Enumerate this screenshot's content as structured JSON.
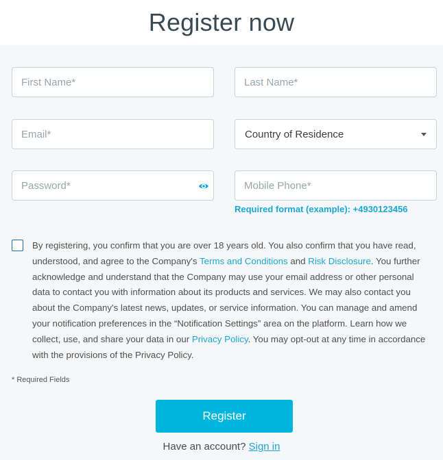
{
  "header": {
    "title": "Register now"
  },
  "form": {
    "first_name": {
      "placeholder": "First Name*"
    },
    "last_name": {
      "placeholder": "Last Name*"
    },
    "email": {
      "placeholder": "Email*"
    },
    "country": {
      "value": "Country of Residence"
    },
    "password": {
      "placeholder": "Password*"
    },
    "mobile": {
      "placeholder": "Mobile Phone*"
    },
    "phone_hint": "Required format (example): +4930123456"
  },
  "consent": {
    "checked": false,
    "part1": "By registering, you confirm that you are over 18 years old. You also confirm that you have read, understood, and agree to the Company's ",
    "terms_link": "Terms and Conditions",
    "and": " and ",
    "risk_link": "Risk Disclosure",
    "part2": ". You further acknowledge and understand that the Company may use your email address or other personal data to contact you with information about its products and services. We may also contact you about the Company's latest news, updates, or service information. You can manage and amend your notification preferences in the “Notification Settings” area on the platform. Learn how we collect, use, and share your data in our ",
    "privacy_link": "Privacy Policy",
    "part3": ". You may opt-out at any time in accordance with the provisions of the Privacy Policy."
  },
  "required_note": "* Required Fields",
  "register_button": "Register",
  "signin": {
    "prompt": "Have an account? ",
    "link": "Sign in"
  },
  "colors": {
    "accent": "#00b6df",
    "link": "#1aa7d4",
    "panel_bg": "#f5f7f9"
  },
  "icons": {
    "password_toggle": "eye-icon",
    "select_caret": "caret-down-icon"
  }
}
